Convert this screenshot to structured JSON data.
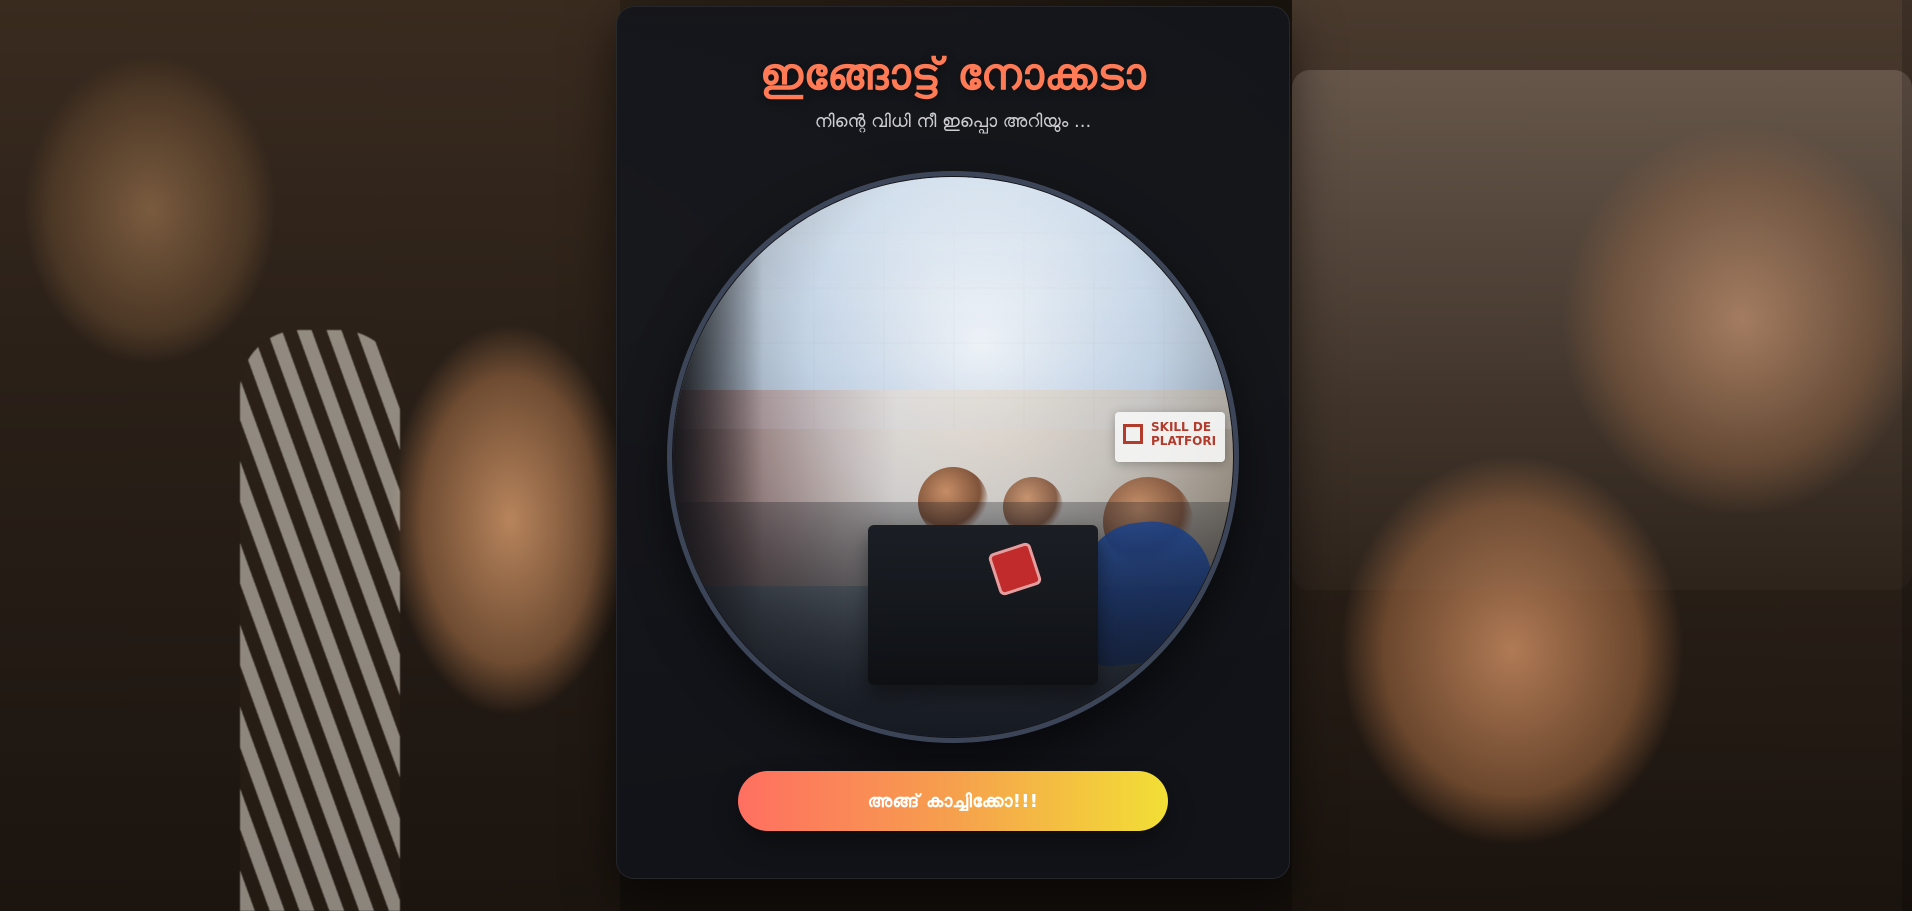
{
  "screen": {
    "title": "ഇങ്ങോട്ട് നോക്കടാ",
    "subtitle": "നിന്റെ വിധി നീ ഇപ്പൊ അറിയും ...",
    "capture_button_label": "അങ്ങ് കാച്ചിക്കോ!!!",
    "camera_preview_banner_text": "SKILL DE\nPLATFORI"
  },
  "colors": {
    "title": "#ff7a55",
    "button_gradient_start": "#ff6f61",
    "button_gradient_mid": "#f6a04d",
    "button_gradient_end": "#f2df35",
    "card_background": "#14161c"
  },
  "icons": {
    "camera_preview": "camera-feed"
  }
}
